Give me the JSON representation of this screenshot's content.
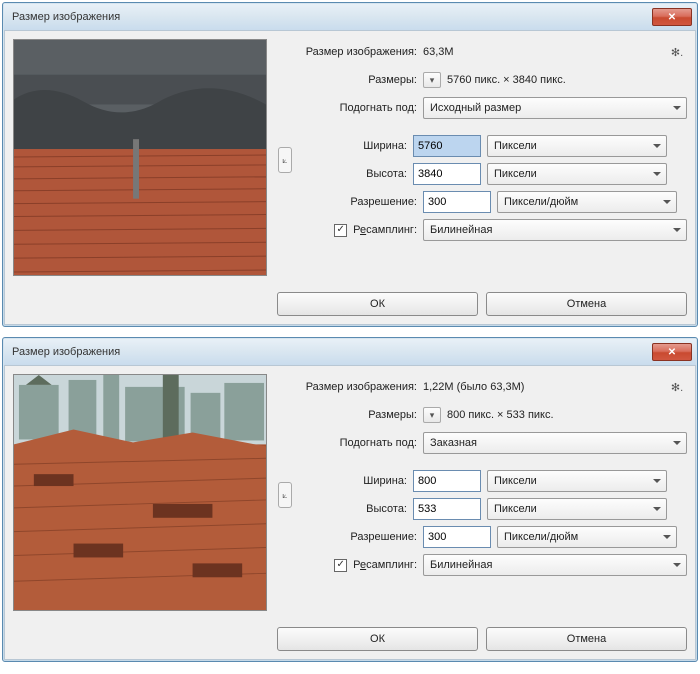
{
  "dialogs": [
    {
      "title": "Размер изображения",
      "size_label": "Размер изображения:",
      "size_value": "63,3M",
      "dims_label": "Размеры:",
      "dims_value": "5760 пикс.  ×  3840 пикс.",
      "fit_label": "Подогнать под:",
      "fit_value": "Исходный размер",
      "width_label": "Ширина:",
      "width_value": "5760",
      "height_label": "Высота:",
      "height_value": "3840",
      "unit_wh": "Пиксели",
      "res_label": "Разрешение:",
      "res_value": "300",
      "res_unit": "Пиксели/дюйм",
      "resample_label": "Ресамплинг:",
      "resample_value": "Билинейная",
      "ok": "ОК",
      "cancel": "Отмена",
      "width_selected": true
    },
    {
      "title": "Размер изображения",
      "size_label": "Размер изображения:",
      "size_value": "1,22M (было 63,3M)",
      "dims_label": "Размеры:",
      "dims_value": "800 пикс.  ×  533 пикс.",
      "fit_label": "Подогнать под:",
      "fit_value": "Заказная",
      "width_label": "Ширина:",
      "width_value": "800",
      "height_label": "Высота:",
      "height_value": "533",
      "unit_wh": "Пиксели",
      "res_label": "Разрешение:",
      "res_value": "300",
      "res_unit": "Пиксели/дюйм",
      "resample_label": "Ресамплинг:",
      "resample_value": "Билинейная",
      "ok": "ОК",
      "cancel": "Отмена",
      "width_selected": false
    }
  ]
}
